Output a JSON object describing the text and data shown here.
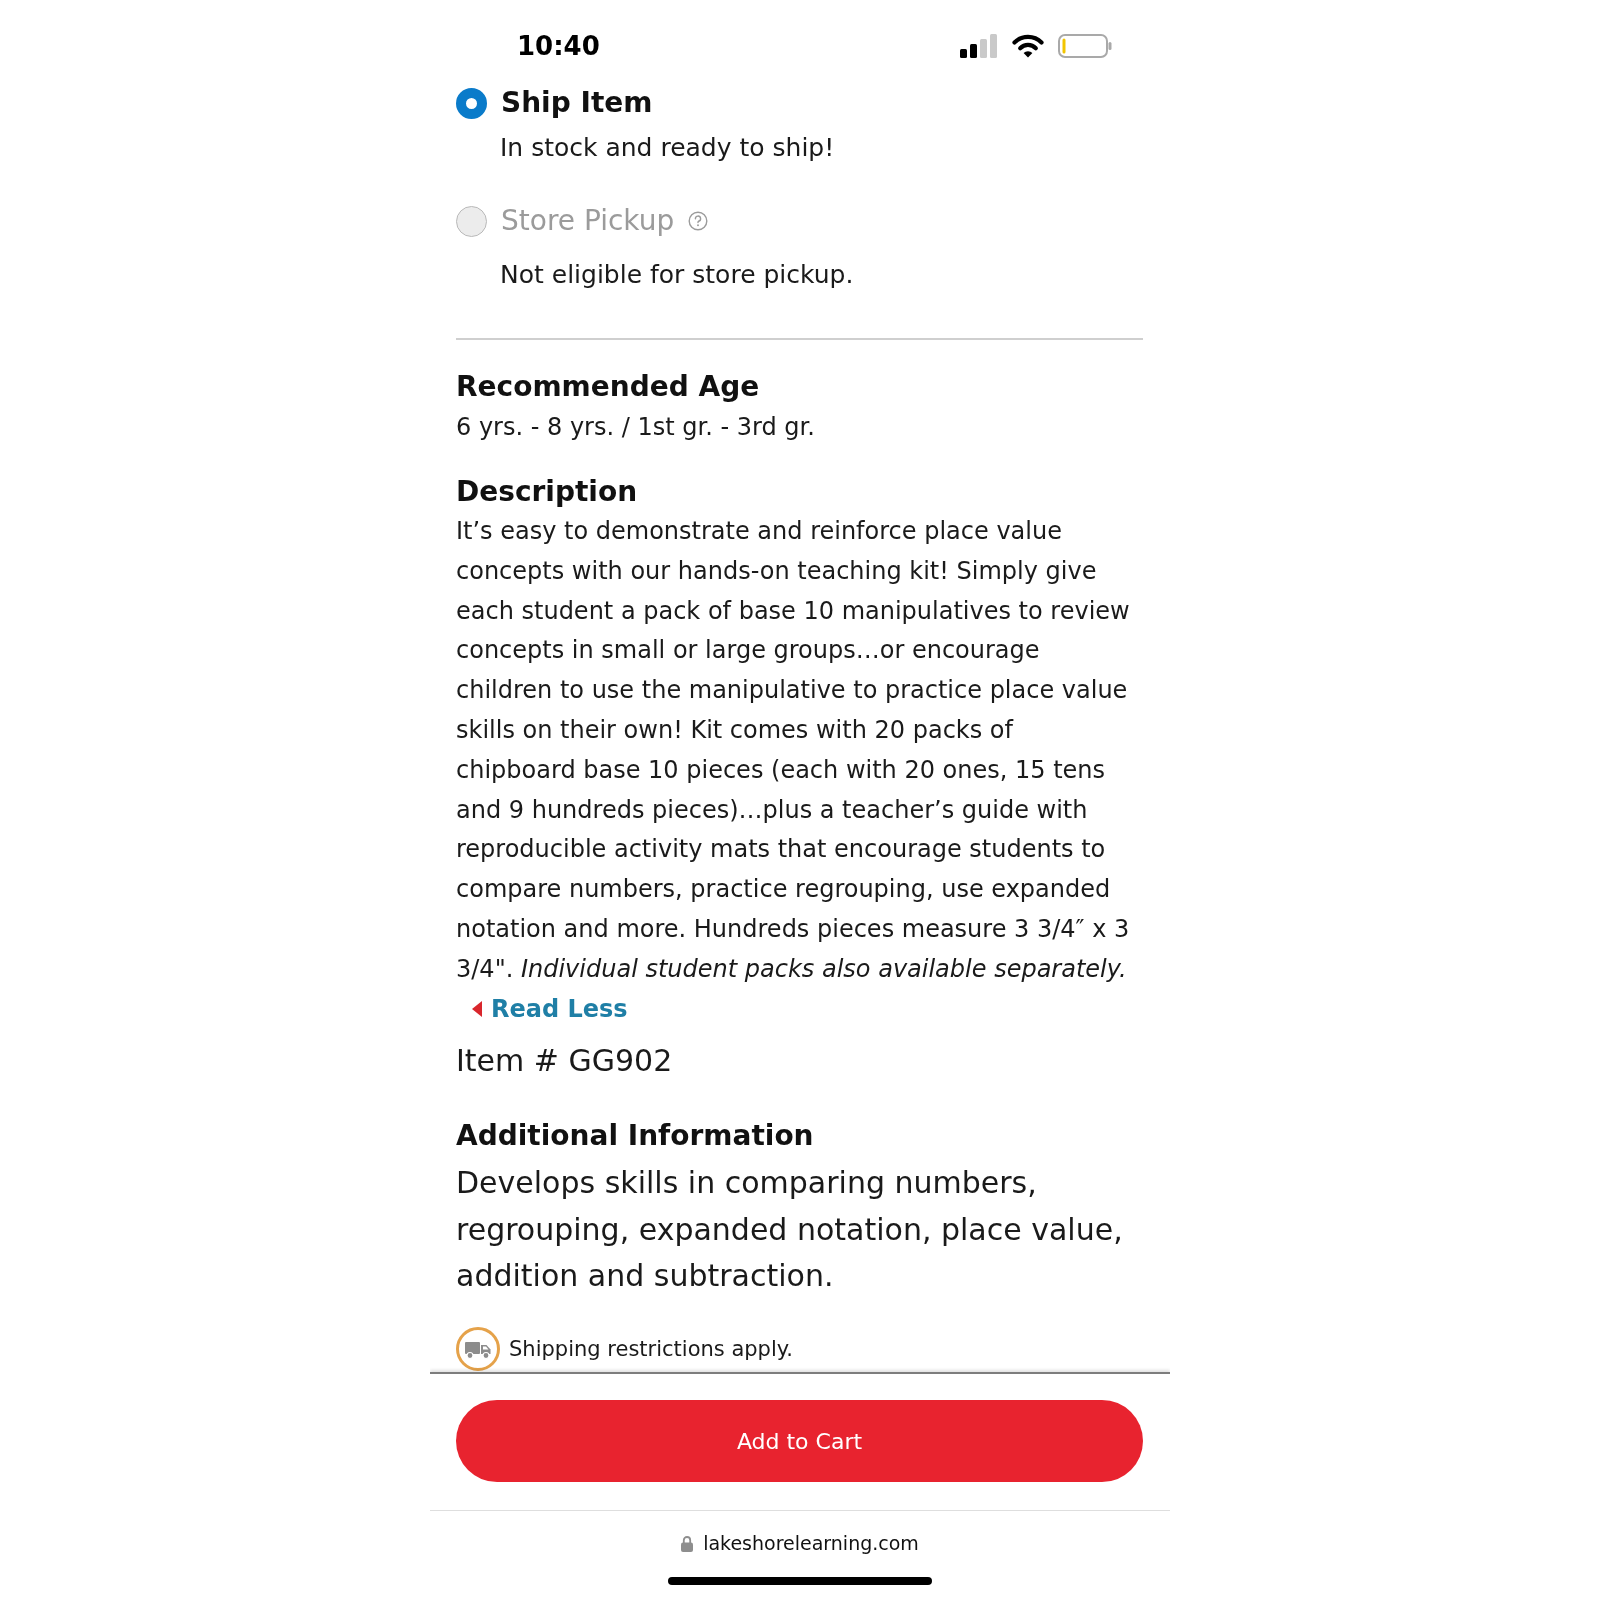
{
  "status_bar": {
    "time": "10:40"
  },
  "delivery_options": [
    {
      "label": "Ship Item",
      "note": "In stock and ready to ship!",
      "selected": true,
      "disabled": false,
      "help": false
    },
    {
      "label": "Store Pickup",
      "note": "Not eligible for store pickup.",
      "selected": false,
      "disabled": true,
      "help": true
    }
  ],
  "recommended_age": {
    "heading": "Recommended Age",
    "value": "6 yrs. - 8 yrs. / 1st gr. - 3rd gr."
  },
  "description": {
    "heading": "Description",
    "text": "It’s easy to demonstrate and reinforce place value concepts with our hands-on teaching kit! Simply give each student a pack of base 10 manipulatives to review concepts in small or large groups…or encourage children to use the manipulative to practice place value skills on their own! Kit comes with 20 packs of chipboard base 10 pieces (each with 20 ones, 15 tens and 9 hundreds pieces)…plus a teacher’s guide with reproducible activity mats that encourage students to compare numbers, practice regrouping, use expanded notation and more. Hundreds pieces measure 3 3/4″ x 3 3/4\". *Individual student packs also available separately.*",
    "link": "Read Less",
    "item_number": "Item # GG902"
  },
  "additional_information": {
    "heading": "Additional Information",
    "text": "Develops skills in comparing numbers, regrouping, expanded notation, place value, addition and subtraction."
  },
  "shipping_notice": "Shipping restrictions apply.",
  "add_to_cart": "Add to Cart",
  "address_bar": {
    "url": "lakeshorelearning.com"
  }
}
